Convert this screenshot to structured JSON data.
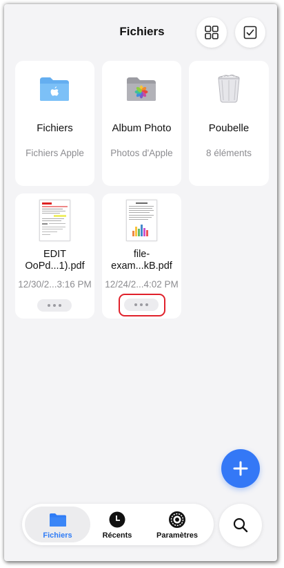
{
  "header": {
    "title": "Fichiers",
    "grid_view_icon": "grid-icon",
    "select_icon": "checkbox-icon"
  },
  "locations": [
    {
      "name": "Fichiers",
      "subtitle": "Fichiers Apple",
      "icon": "blue-folder-apple-icon"
    },
    {
      "name": "Album Photo",
      "subtitle": "Photos d'Apple",
      "icon": "gray-folder-photos-icon"
    },
    {
      "name": "Poubelle",
      "subtitle": "8 éléments",
      "icon": "trash-bin-icon"
    }
  ],
  "files": [
    {
      "name_line1": "EDIT",
      "name_line2": "OoPd...1).pdf",
      "date": "12/30/2...3:16 PM",
      "more_icon": "more-dots-icon"
    },
    {
      "name_line1": "file-",
      "name_line2": "exam...kB.pdf",
      "date": "12/24/2...4:02 PM",
      "more_icon": "more-dots-icon"
    }
  ],
  "fab": {
    "icon": "plus-icon"
  },
  "tabbar": {
    "tabs": [
      {
        "label": "Fichiers",
        "icon": "folder-icon",
        "active": true
      },
      {
        "label": "Récents",
        "icon": "clock-icon",
        "active": false
      },
      {
        "label": "Paramètres",
        "icon": "gear-icon",
        "active": false
      }
    ]
  },
  "search": {
    "icon": "search-icon"
  },
  "colors": {
    "accent": "#3478f6",
    "highlight": "#e0202a",
    "background": "#f4f4f6"
  }
}
